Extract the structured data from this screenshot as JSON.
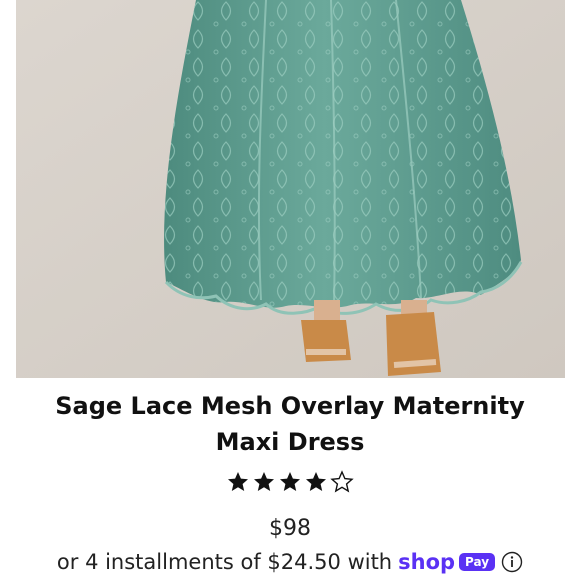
{
  "product": {
    "title": "Sage Lace Mesh Overlay Maternity Maxi Dress",
    "rating": 4,
    "rating_max": 5,
    "price": "$98",
    "installments_text": "or 4 installments of $24.50 with",
    "shop_pay": {
      "shop_label": "shop",
      "pay_label": "Pay",
      "brand_color": "#5a31f4"
    }
  },
  "icons": {
    "star_filled": "star-filled-icon",
    "star_empty": "star-empty-icon",
    "info": "info-icon"
  },
  "colors": {
    "dress": "#5f9c8f",
    "background": "#d9d3cc",
    "sandal": "#c98a48"
  }
}
